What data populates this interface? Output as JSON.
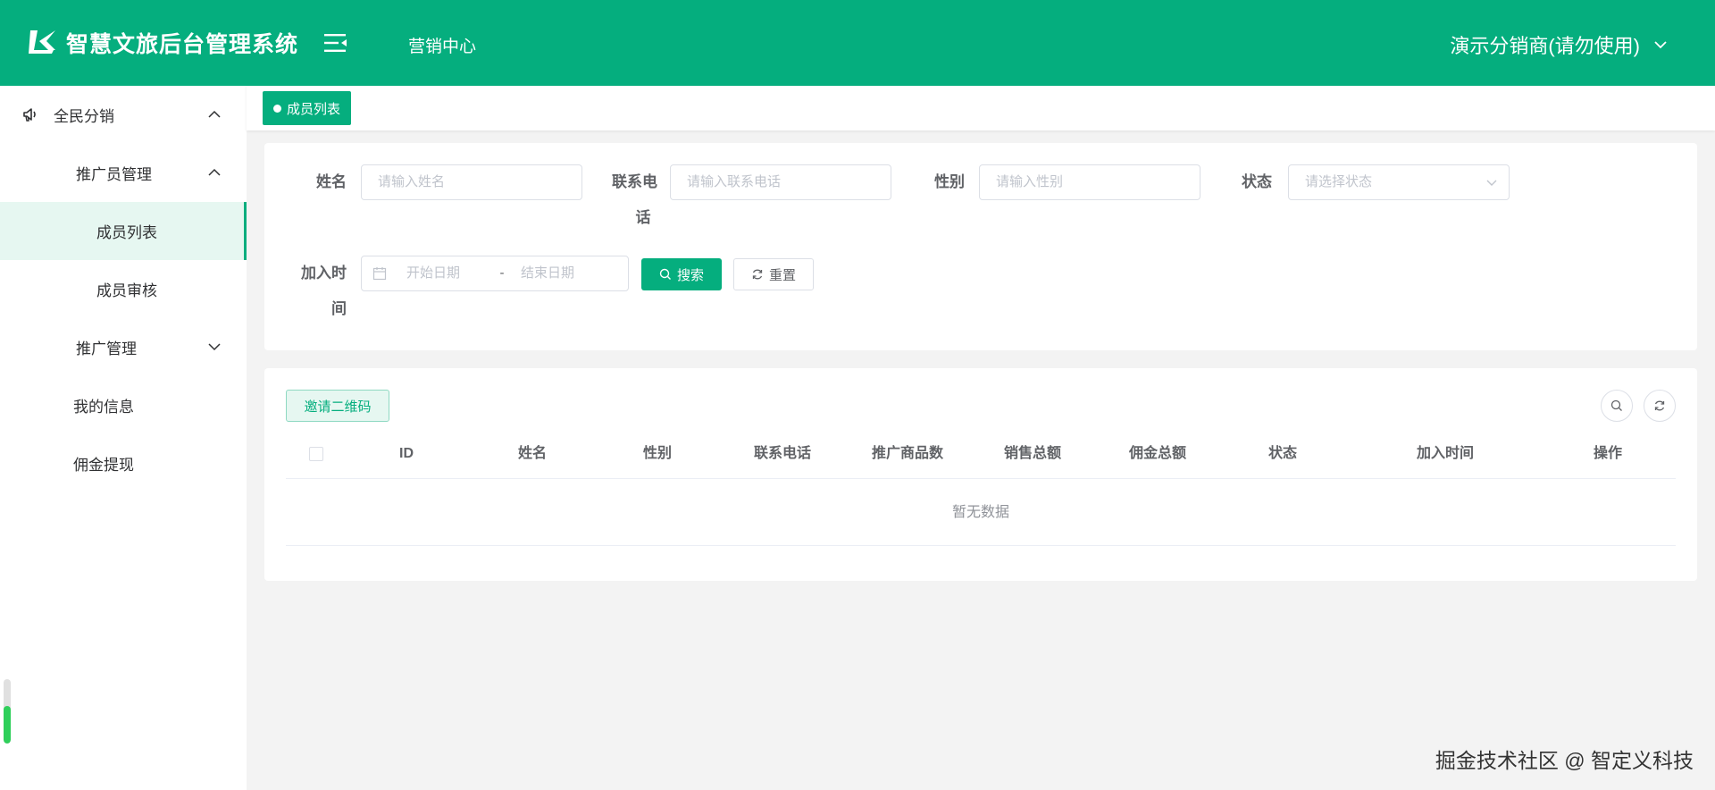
{
  "header": {
    "app_title": "智慧文旅后台管理系统",
    "nav_item": "营销中心",
    "user": "演示分销商(请勿使用)"
  },
  "sidebar": {
    "items": [
      {
        "label": "全民分销",
        "expanded": true,
        "icon": "megaphone-icon"
      },
      {
        "label": "推广员管理",
        "expanded": true
      },
      {
        "label": "成员列表",
        "active": true
      },
      {
        "label": "成员审核"
      },
      {
        "label": "推广管理",
        "expanded": false
      },
      {
        "label": "我的信息"
      },
      {
        "label": "佣金提现"
      }
    ]
  },
  "tabs": [
    {
      "label": "成员列表",
      "active": true
    }
  ],
  "search_form": {
    "name_label": "姓名",
    "name_placeholder": "请输入姓名",
    "phone_label_line1": "联系电",
    "phone_label_line2": "话",
    "phone_placeholder": "请输入联系电话",
    "gender_label": "性别",
    "gender_placeholder": "请输入性别",
    "status_label": "状态",
    "status_placeholder": "请选择状态",
    "join_label_line1": "加入时",
    "join_label_line2": "间",
    "start_placeholder": "开始日期",
    "date_separator": "-",
    "end_placeholder": "结束日期",
    "search_button": "搜索",
    "reset_button": "重置"
  },
  "table": {
    "invite_button": "邀请二维码",
    "columns": [
      "ID",
      "姓名",
      "性别",
      "联系电话",
      "推广商品数",
      "销售总额",
      "佣金总额",
      "状态",
      "加入时间",
      "操作"
    ],
    "empty_text": "暂无数据"
  },
  "watermark": "掘金技术社区 @ 智定义科技",
  "colors": {
    "primary": "#05ae7e",
    "active_bg": "#e6f7f1"
  }
}
